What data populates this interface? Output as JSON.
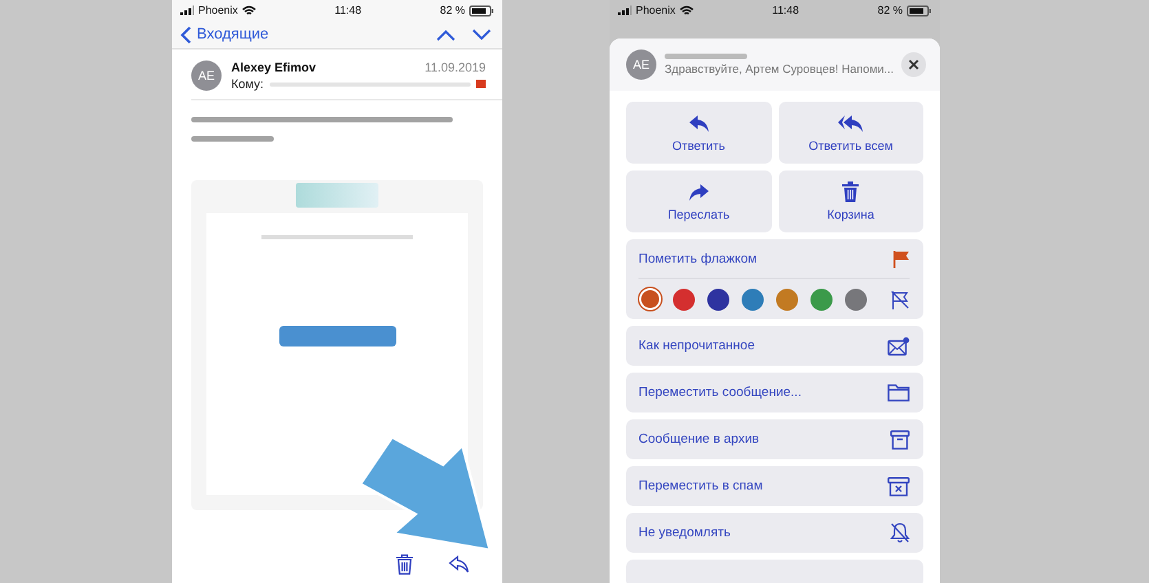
{
  "left_phone": {
    "status": {
      "carrier": "Phoenix",
      "time": "11:48",
      "battery": "82 %"
    },
    "nav": {
      "back_label": "Входящие"
    },
    "message": {
      "initials": "AE",
      "sender": "Alexey Efimov",
      "date": "11.09.2019",
      "to_label": "Кому:",
      "flagged": true
    }
  },
  "right_phone": {
    "status": {
      "carrier": "Phoenix",
      "time": "11:48",
      "battery": "82 %"
    },
    "sheet": {
      "initials": "AE",
      "preview": "Здравствуйте, Артем Суровцев! Напоми...",
      "actions": [
        {
          "label": "Ответить",
          "kind": "reply"
        },
        {
          "label": "Ответить всем",
          "kind": "reply-all"
        },
        {
          "label": "Переслать",
          "kind": "forward"
        },
        {
          "label": "Корзина",
          "kind": "trash"
        }
      ],
      "flag": {
        "label": "Пометить флажком",
        "colors": [
          {
            "color": "#c8501e",
            "selected": true
          },
          {
            "color": "#d42f2f",
            "selected": false
          },
          {
            "color": "#2e33a0",
            "selected": false
          },
          {
            "color": "#2e7db8",
            "selected": false
          },
          {
            "color": "#c27a22",
            "selected": false
          },
          {
            "color": "#3b9a4a",
            "selected": false
          },
          {
            "color": "#77777b",
            "selected": false
          }
        ]
      },
      "items": [
        {
          "label": "Как непрочитанное",
          "kind": "unread"
        },
        {
          "label": "Переместить сообщение...",
          "kind": "move"
        },
        {
          "label": "Сообщение в архив",
          "kind": "archive"
        },
        {
          "label": "Переместить в спам",
          "kind": "spam"
        },
        {
          "label": "Не уведомлять",
          "kind": "mute"
        }
      ]
    }
  }
}
